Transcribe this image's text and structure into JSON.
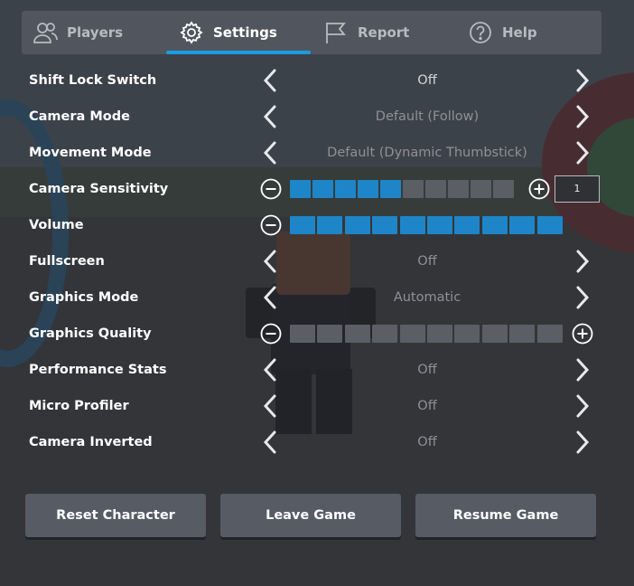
{
  "tabs": [
    {
      "label": "Players",
      "icon": "players-icon",
      "active": false
    },
    {
      "label": "Settings",
      "icon": "gear-icon",
      "active": true
    },
    {
      "label": "Report",
      "icon": "flag-icon",
      "active": false
    },
    {
      "label": "Help",
      "icon": "help-icon",
      "active": false
    }
  ],
  "settings": {
    "shift_lock": {
      "label": "Shift Lock Switch",
      "value": "Off"
    },
    "camera_mode": {
      "label": "Camera Mode",
      "value": "Default (Follow)"
    },
    "movement_mode": {
      "label": "Movement Mode",
      "value": "Default (Dynamic Thumbstick)"
    },
    "camera_sensitivity": {
      "label": "Camera Sensitivity",
      "level": 5,
      "max": 10,
      "input_value": "1"
    },
    "volume": {
      "label": "Volume",
      "level": 10,
      "max": 10
    },
    "fullscreen": {
      "label": "Fullscreen",
      "value": "Off"
    },
    "graphics_mode": {
      "label": "Graphics Mode",
      "value": "Automatic"
    },
    "graphics_quality": {
      "label": "Graphics Quality",
      "level": 0,
      "max": 10
    },
    "performance_stats": {
      "label": "Performance Stats",
      "value": "Off"
    },
    "micro_profiler": {
      "label": "Micro Profiler",
      "value": "Off"
    },
    "camera_inverted": {
      "label": "Camera Inverted",
      "value": "Off"
    }
  },
  "buttons": {
    "reset": "Reset Character",
    "leave": "Leave Game",
    "resume": "Resume Game"
  },
  "colors": {
    "accent": "#1c9be0",
    "slider_on": "#1e86c8",
    "slider_off": "#5b5e64",
    "button_bg": "#575b64"
  }
}
